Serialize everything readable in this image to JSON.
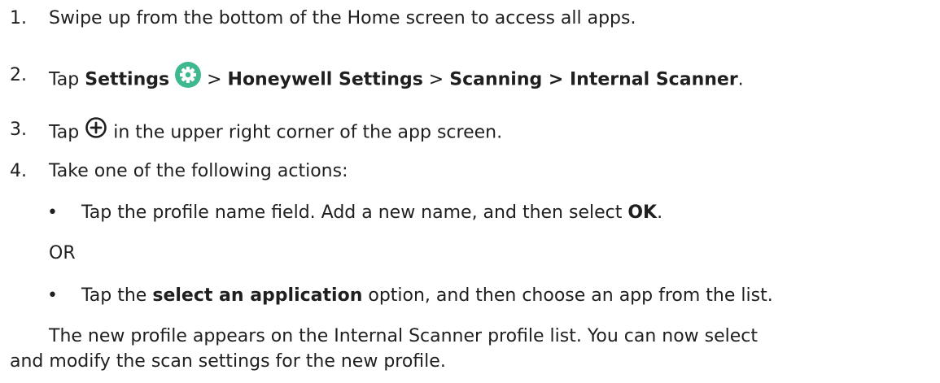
{
  "steps": [
    {
      "num": "1.",
      "text": "Swipe up from the bottom of the Home screen to access all apps."
    },
    {
      "num": "2.",
      "a": "Tap ",
      "settings": "Settings",
      "sep1": " > ",
      "honeywell": "Honeywell Settings",
      "sep2": " > ",
      "path": "Scanning > Internal Scanner",
      "end": "."
    },
    {
      "num": "3.",
      "a": "Tap ",
      "b": " in the upper right corner of the app screen."
    },
    {
      "num": "4.",
      "text": "Take one of the following actions:"
    }
  ],
  "options": {
    "bullet": "•",
    "opt1_text": "Tap the profile name field. Add a new name, and then select ",
    "opt1_bold": "OK",
    "opt1_end": ".",
    "or": "OR",
    "opt2_a": "Tap the ",
    "opt2_bold": "select an application",
    "opt2_b": " option, and then choose an app from the list."
  },
  "result": {
    "line1": "The new profile appears on the Internal Scanner profile list. You can now select",
    "line2": "and modify the scan settings for the new profile."
  },
  "icons": {
    "settings": "settings-gear-icon",
    "add": "add-circle-icon"
  },
  "colors": {
    "text": "#1f1f1f",
    "settings_icon": "#3db890"
  }
}
